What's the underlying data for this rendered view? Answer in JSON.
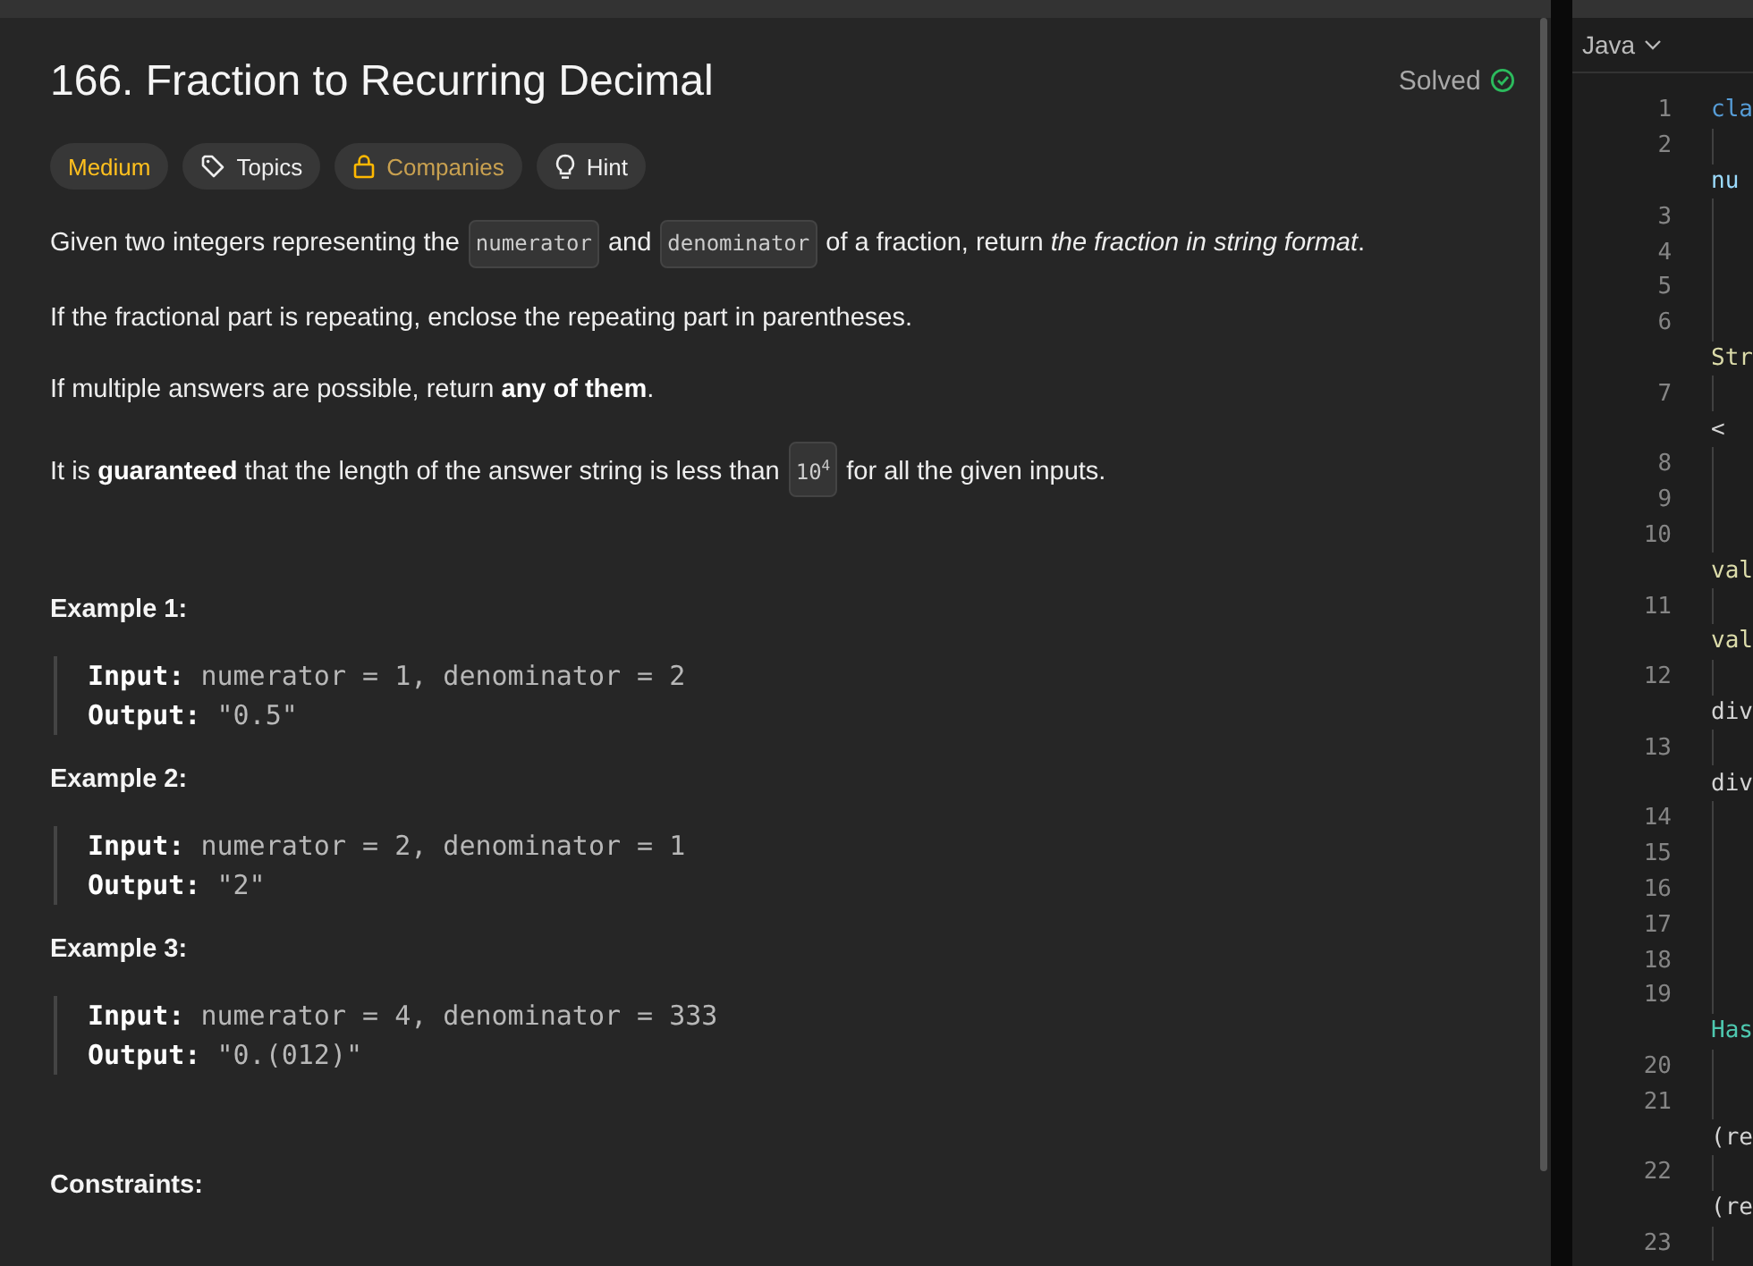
{
  "problem": {
    "title": "166. Fraction to Recurring Decimal",
    "status": "Solved",
    "solved": true,
    "tags": [
      {
        "kind": "difficulty",
        "label": "Medium"
      },
      {
        "kind": "topics",
        "label": "Topics"
      },
      {
        "kind": "companies",
        "label": "Companies"
      },
      {
        "kind": "hint",
        "label": "Hint"
      }
    ],
    "paragraphs": [
      [
        {
          "kind": "text",
          "text": "Given two integers representing the"
        },
        {
          "kind": "code",
          "text": "numerator"
        },
        {
          "kind": "text",
          "text": "and"
        },
        {
          "kind": "code",
          "text": "denominator"
        },
        {
          "kind": "text",
          "text": "of a fraction, return *the fraction in string format*."
        }
      ],
      [
        {
          "kind": "text",
          "text": "If the fractional part is repeating, enclose the repeating part in parentheses."
        }
      ],
      [
        {
          "kind": "text",
          "text": "If multiple answers are possible, return **any of them**."
        }
      ],
      [
        {
          "kind": "text",
          "text": "It is **guaranteed** that the length of the answer string is less than"
        },
        {
          "kind": "code",
          "text": "10$^{4}$"
        },
        {
          "kind": "text",
          "text": "for all the given inputs."
        }
      ]
    ],
    "examples": [
      {
        "heading": "Example 1:",
        "input": "numerator = 1, denominator = 2",
        "output": "\"0.5\"",
        "input_label": "Input:",
        "output_label": "Output:"
      },
      {
        "heading": "Example 2:",
        "input": "numerator = 2, denominator = 1",
        "output": "\"2\"",
        "input_label": "Input:",
        "output_label": "Output:"
      },
      {
        "heading": "Example 3:",
        "input": "numerator = 4, denominator = 333",
        "output": "\"0.(012)\"",
        "input_label": "Input:",
        "output_label": "Output:"
      }
    ],
    "constraints_heading": "Constraints:"
  },
  "code_editor": {
    "language": "Java",
    "rows": [
      {
        "number": "1",
        "text": "cla",
        "color": "#569cd6"
      },
      {
        "number": "2"
      },
      {
        "text": "nu",
        "color": "#9cdcfe"
      },
      {
        "number": "3"
      },
      {
        "number": "4"
      },
      {
        "number": "5"
      },
      {
        "number": "6"
      },
      {
        "text": "Str",
        "color": "#dcdcaa"
      },
      {
        "number": "7"
      },
      {
        "text": "<",
        "color": "#d4d4d4"
      },
      {
        "number": "8"
      },
      {
        "number": "9"
      },
      {
        "number": "10"
      },
      {
        "text": "val",
        "color": "#dcdcaa"
      },
      {
        "number": "11"
      },
      {
        "text": "val",
        "color": "#dcdcaa"
      },
      {
        "number": "12"
      },
      {
        "text": "div",
        "color": "#d4d4d4"
      },
      {
        "number": "13"
      },
      {
        "text": "div",
        "color": "#d4d4d4"
      },
      {
        "number": "14"
      },
      {
        "number": "15"
      },
      {
        "number": "16"
      },
      {
        "number": "17"
      },
      {
        "number": "18"
      },
      {
        "number": "19"
      },
      {
        "text": "Has",
        "color": "#4ec9b0"
      },
      {
        "number": "20"
      },
      {
        "number": "21"
      },
      {
        "text": "(re",
        "color": "#d4d4d4"
      },
      {
        "number": "22"
      },
      {
        "text": "(re",
        "color": "#d4d4d4"
      },
      {
        "number": "23"
      }
    ]
  }
}
